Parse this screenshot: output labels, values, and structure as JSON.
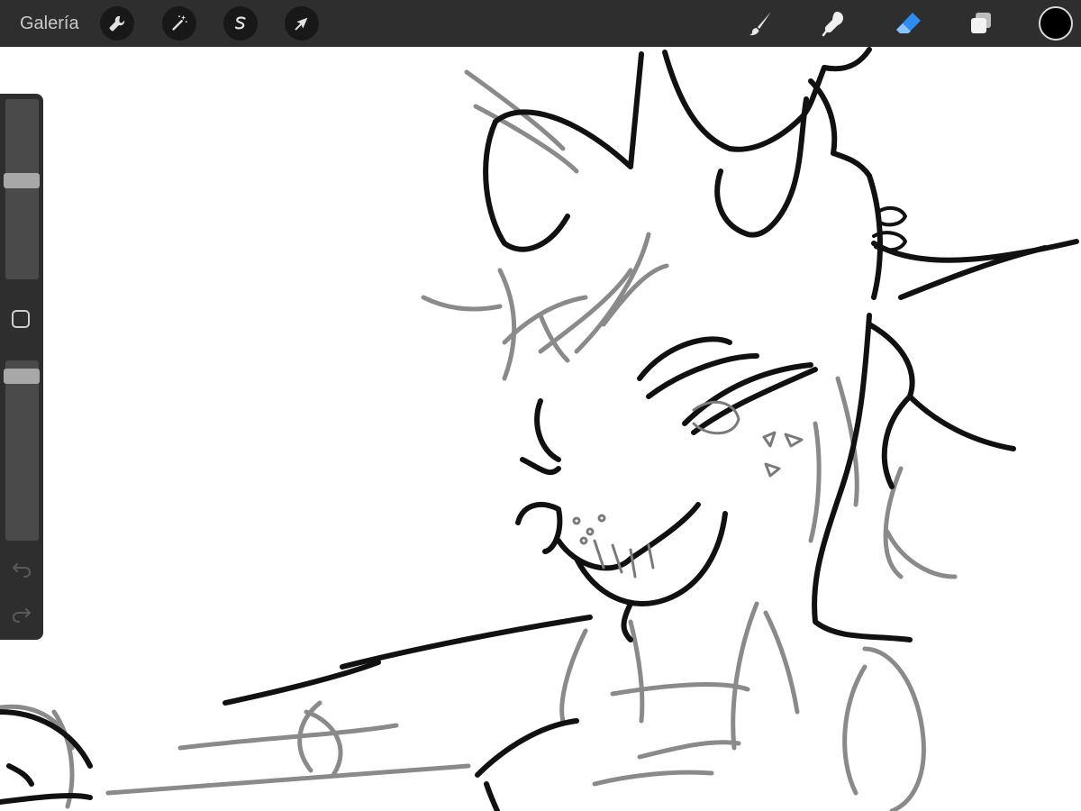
{
  "toolbar": {
    "gallery_label": "Galería",
    "left_tools": [
      {
        "name": "actions",
        "icon": "wrench-icon"
      },
      {
        "name": "adjustments",
        "icon": "magic-wand-icon"
      },
      {
        "name": "selection",
        "icon": "selection-s-icon"
      },
      {
        "name": "transform",
        "icon": "arrow-cursor-icon"
      }
    ],
    "right_tools": [
      {
        "name": "brush",
        "icon": "brush-icon",
        "active": false
      },
      {
        "name": "smudge",
        "icon": "smudge-finger-icon",
        "active": false
      },
      {
        "name": "eraser",
        "icon": "eraser-icon",
        "active": true
      },
      {
        "name": "layers",
        "icon": "layers-icon",
        "active": false
      }
    ],
    "current_color": "#000000",
    "accent_color": "#2f8cf0"
  },
  "sidebar": {
    "brush_size_level": 0.55,
    "brush_opacity_level": 0.95,
    "buttons": [
      "modify-square-icon",
      "undo-icon",
      "redo-icon"
    ]
  },
  "canvas": {
    "background": "#ffffff",
    "content": "sketch-drawing"
  }
}
